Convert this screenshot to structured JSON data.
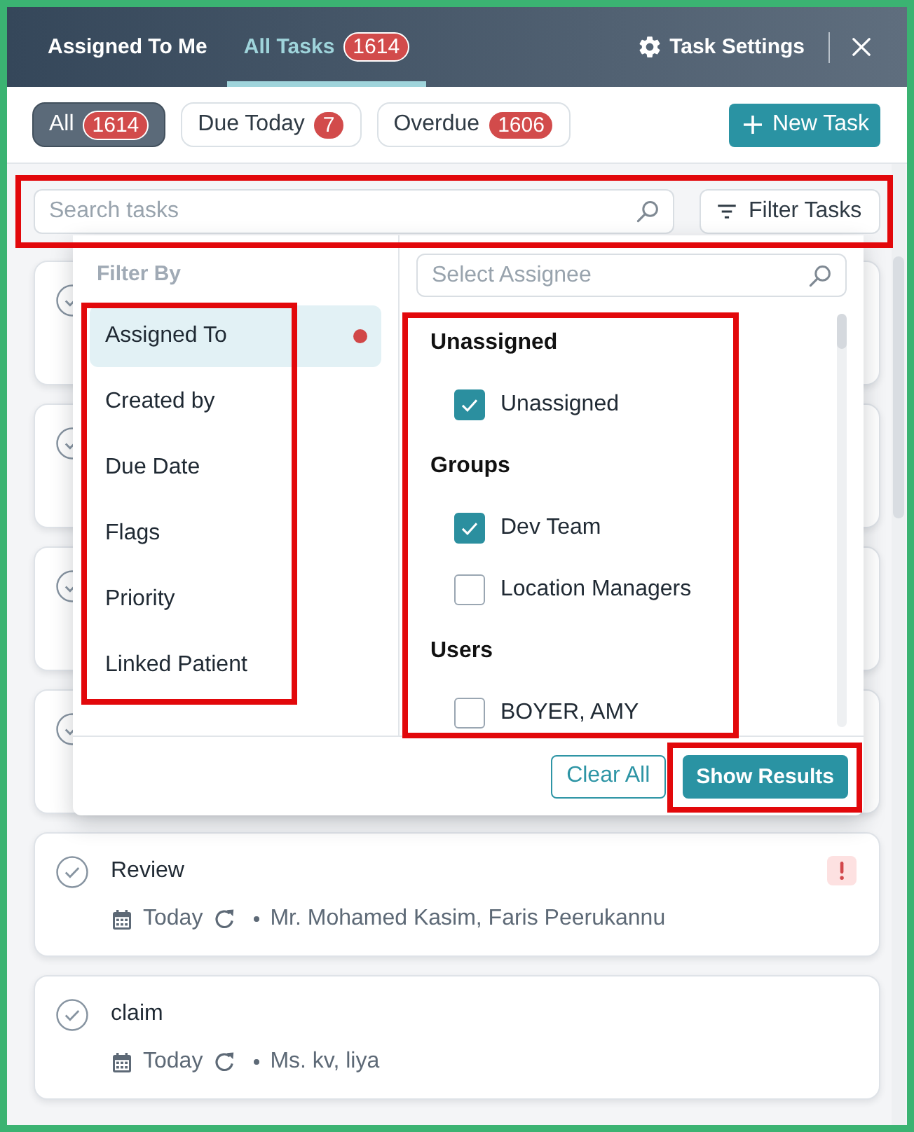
{
  "header": {
    "tabs": [
      {
        "label": "Assigned To Me",
        "selected": false
      },
      {
        "label": "All Tasks",
        "count": "1614",
        "selected": true
      }
    ],
    "settings": "Task Settings"
  },
  "filter_chips": [
    {
      "label": "All",
      "count": "1614",
      "selected": true
    },
    {
      "label": "Due Today",
      "count": "7",
      "selected": false
    },
    {
      "label": "Overdue",
      "count": "1606",
      "selected": false
    }
  ],
  "new_task_button": "New Task",
  "search": {
    "placeholder": "Search tasks",
    "highlighted": true
  },
  "filter_button": "Filter Tasks",
  "filter_panel": {
    "title": "Filter By",
    "categories": [
      {
        "label": "Assigned To",
        "selected": true,
        "filtered": true
      },
      {
        "label": "Created by",
        "selected": false,
        "filtered": false
      },
      {
        "label": "Due Date",
        "selected": false,
        "filtered": false
      },
      {
        "label": "Flags",
        "selected": false,
        "filtered": false
      },
      {
        "label": "Priority",
        "selected": false,
        "filtered": false
      },
      {
        "label": "Linked Patient",
        "selected": false,
        "filtered": false
      }
    ],
    "categories_highlighted": true,
    "assignee_search": {
      "placeholder": "Select Assignee"
    },
    "assignee_groups": [
      {
        "heading": "Unassigned",
        "options": [
          {
            "label": "Unassigned",
            "checked": true
          }
        ]
      },
      {
        "heading": "Groups",
        "options": [
          {
            "label": "Dev Team",
            "checked": true
          },
          {
            "label": "Location Managers",
            "checked": false
          }
        ]
      },
      {
        "heading": "Users",
        "options": [
          {
            "label": "BOYER, AMY",
            "checked": false
          }
        ]
      }
    ],
    "assignees_highlighted": true,
    "buttons": [
      {
        "label": "Clear All",
        "kind": "outline",
        "highlighted": false
      },
      {
        "label": "Show Results",
        "kind": "primary",
        "highlighted": true
      }
    ]
  },
  "tasks": [
    {
      "title": "Review",
      "due": "Today",
      "recurring": true,
      "assignees": "Mr. Mohamed Kasim, Faris Peerukannu",
      "flagged": true
    },
    {
      "title": "claim",
      "due": "Today",
      "recurring": true,
      "assignees": "Ms. kv, liya",
      "flagged": false
    }
  ]
}
